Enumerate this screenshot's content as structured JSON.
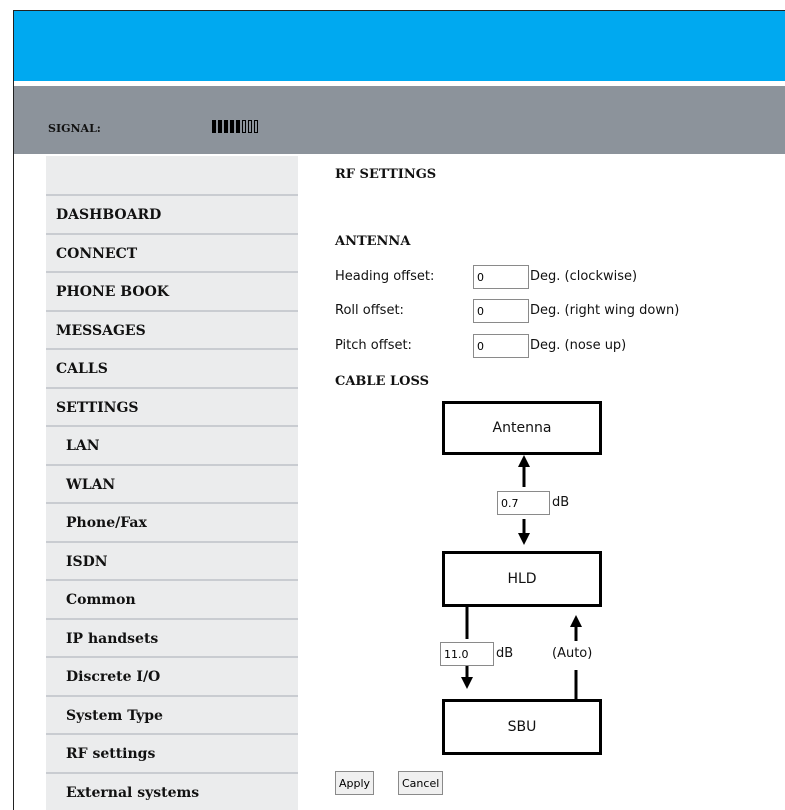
{
  "header": {
    "signal_label": "SIGNAL:",
    "signal_level": 5,
    "signal_max": 8
  },
  "sidebar": {
    "items": [
      {
        "label": "DASHBOARD",
        "sub": false
      },
      {
        "label": "CONNECT",
        "sub": false
      },
      {
        "label": "PHONE BOOK",
        "sub": false
      },
      {
        "label": "MESSAGES",
        "sub": false
      },
      {
        "label": "CALLS",
        "sub": false
      },
      {
        "label": "SETTINGS",
        "sub": false
      },
      {
        "label": "LAN",
        "sub": true
      },
      {
        "label": "WLAN",
        "sub": true
      },
      {
        "label": "Phone/Fax",
        "sub": true
      },
      {
        "label": "ISDN",
        "sub": true
      },
      {
        "label": "Common",
        "sub": true
      },
      {
        "label": "IP handsets",
        "sub": true
      },
      {
        "label": "Discrete I/O",
        "sub": true
      },
      {
        "label": "System Type",
        "sub": true
      },
      {
        "label": "RF settings",
        "sub": true
      },
      {
        "label": "External systems",
        "sub": true
      }
    ]
  },
  "page": {
    "title": "RF SETTINGS",
    "antenna_heading": "ANTENNA",
    "heading_offset": {
      "label": "Heading offset:",
      "value": "0",
      "unit": "Deg. (clockwise)"
    },
    "roll_offset": {
      "label": "Roll offset:",
      "value": "0",
      "unit": "Deg. (right wing down)"
    },
    "pitch_offset": {
      "label": "Pitch offset:",
      "value": "0",
      "unit": "Deg. (nose up)"
    },
    "cable_loss_heading": "CABLE LOSS"
  },
  "diagram": {
    "antenna_label": "Antenna",
    "hld_label": "HLD",
    "sbu_label": "SBU",
    "antenna_hld_loss": "0.7",
    "hld_sbu_loss": "11.0",
    "unit": "dB",
    "auto_label": "(Auto)"
  },
  "buttons": {
    "apply": "Apply",
    "cancel": "Cancel"
  },
  "colors": {
    "topbar": "#00a9f0",
    "signalbar": "#8c939b",
    "sidebar": "#ebeced"
  }
}
